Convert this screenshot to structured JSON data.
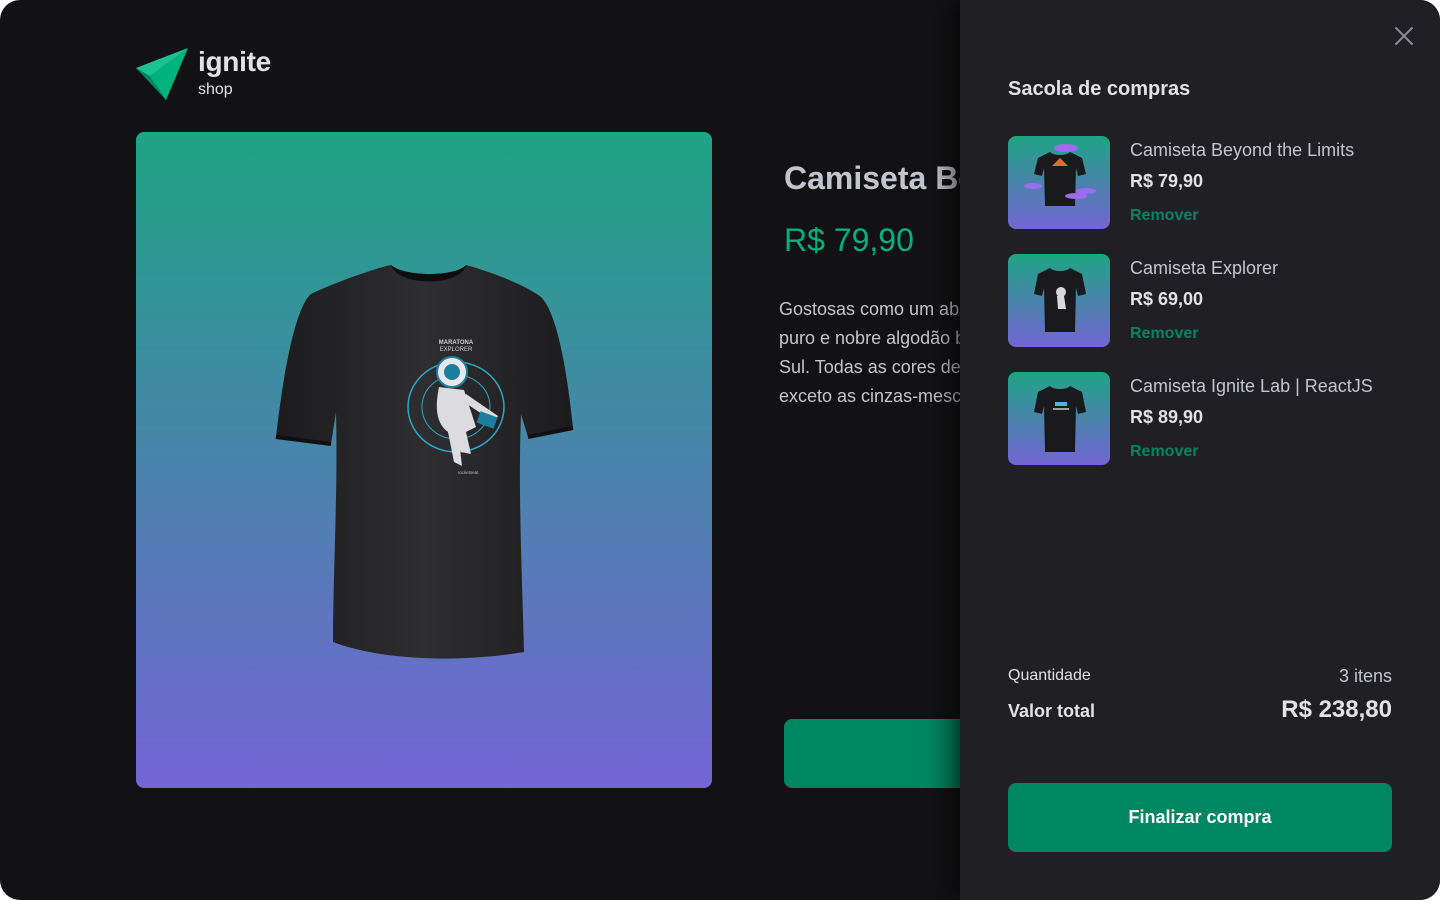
{
  "brand": {
    "title": "ignite",
    "subtitle": "shop",
    "accent": "#00875f",
    "accent_light": "#00b37e"
  },
  "product": {
    "title": "Camiseta Be",
    "price": "R$ 79,90",
    "description_lines": [
      "Gostosas como um ab",
      "puro e nobre algodão b",
      "Sul. Todas as cores de",
      "exceto as cinzas-mesc"
    ],
    "image_print": {
      "line1": "MARATONA",
      "line2": "EXPLORER",
      "brand": "rocketseat"
    }
  },
  "cart": {
    "title": "Sacola de compras",
    "close_icon": "close-icon",
    "items": [
      {
        "name": "Camiseta Beyond the Limits",
        "price": "R$ 79,90",
        "remove_label": "Remover"
      },
      {
        "name": "Camiseta Explorer",
        "price": "R$ 69,00",
        "remove_label": "Remover"
      },
      {
        "name": "Camiseta Ignite Lab | ReactJS",
        "price": "R$ 89,90",
        "remove_label": "Remover"
      }
    ],
    "quantity_label": "Quantidade",
    "quantity_value": "3 itens",
    "total_label": "Valor total",
    "total_value": "R$ 238,80",
    "checkout_label": "Finalizar compra"
  }
}
